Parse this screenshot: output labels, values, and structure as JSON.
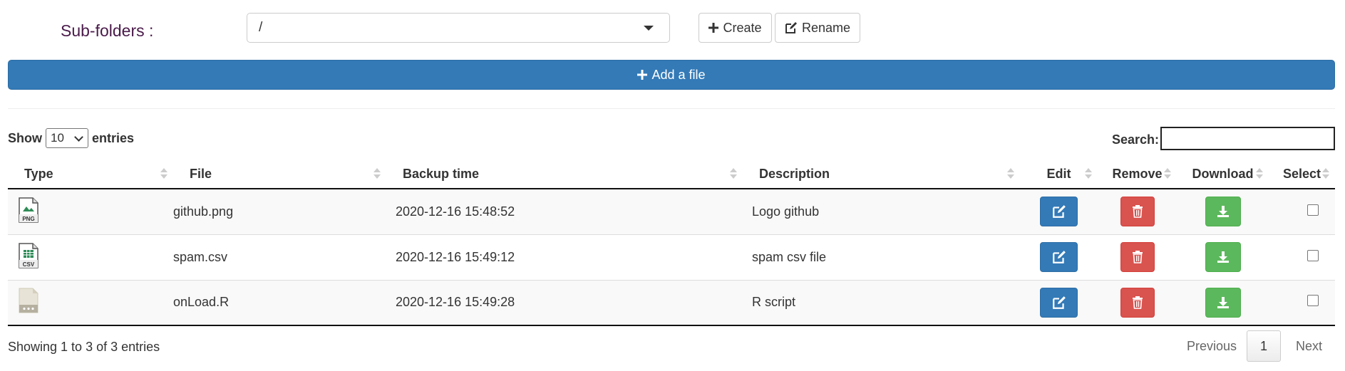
{
  "subfolders": {
    "label": "Sub-folders :",
    "selected": "/",
    "create_label": "Create",
    "rename_label": "Rename"
  },
  "add_file_label": "Add a file",
  "length_menu": {
    "show": "Show",
    "value": "10",
    "entries": "entries"
  },
  "search": {
    "label": "Search:",
    "value": ""
  },
  "columns": {
    "type": "Type",
    "file": "File",
    "backup_time": "Backup time",
    "description": "Description",
    "edit": "Edit",
    "remove": "Remove",
    "download": "Download",
    "select": "Select"
  },
  "rows": [
    {
      "type_icon": "png-file-icon",
      "file": "github.png",
      "backup_time": "2020-12-16 15:48:52",
      "description": "Logo github"
    },
    {
      "type_icon": "csv-file-icon",
      "file": "spam.csv",
      "backup_time": "2020-12-16 15:49:12",
      "description": "spam csv file"
    },
    {
      "type_icon": "generic-file-icon",
      "file": "onLoad.R",
      "backup_time": "2020-12-16 15:49:28",
      "description": "R script"
    }
  ],
  "icon_text": {
    "png": "PNG",
    "csv": "CSV"
  },
  "info": "Showing 1 to 3 of 3 entries",
  "pagination": {
    "previous": "Previous",
    "current": "1",
    "next": "Next"
  },
  "colors": {
    "primary": "#337ab7",
    "danger": "#d9534f",
    "success": "#5cb85c",
    "label_purple": "#4a1a4a"
  }
}
